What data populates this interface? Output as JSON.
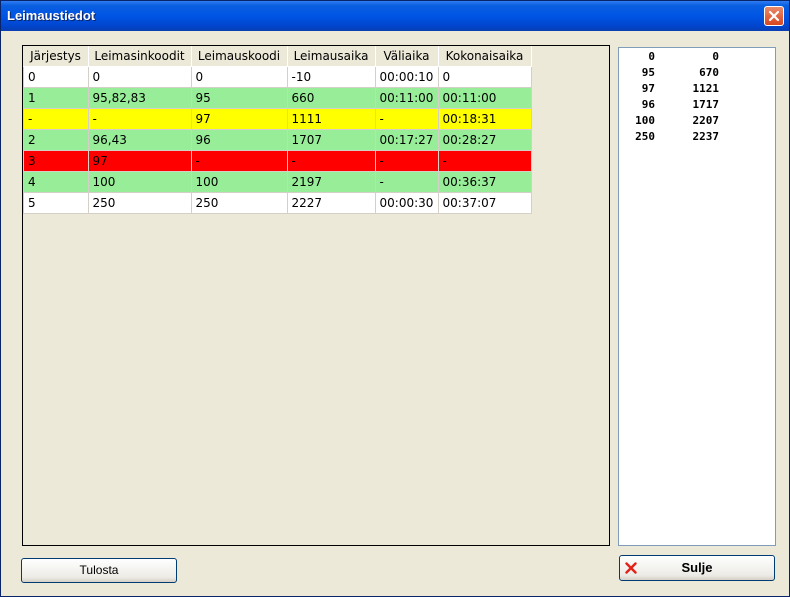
{
  "window": {
    "title": "Leimaustiedot"
  },
  "table": {
    "headers": [
      "Järjestys",
      "Leimasinkoodit",
      "Leimauskoodi",
      "Leimausaika",
      "Väliaika",
      "Kokonaisaika"
    ],
    "rows": [
      {
        "cells": [
          "0",
          "0",
          "0",
          "-10",
          "00:00:10",
          "0"
        ],
        "color": "#ffffff"
      },
      {
        "cells": [
          "1",
          "95,82,83",
          "95",
          "660",
          "00:11:00",
          "00:11:00"
        ],
        "color": "#98ee98"
      },
      {
        "cells": [
          "-",
          "-",
          "97",
          "1111",
          "-",
          "00:18:31"
        ],
        "color": "#ffff00"
      },
      {
        "cells": [
          "2",
          "96,43",
          "96",
          "1707",
          "00:17:27",
          "00:28:27"
        ],
        "color": "#98ee98"
      },
      {
        "cells": [
          "3",
          "97",
          "-",
          "-",
          "-",
          "-"
        ],
        "color": "#ff0000"
      },
      {
        "cells": [
          "4",
          "100",
          "100",
          "2197",
          "-",
          "00:36:37"
        ],
        "color": "#98ee98"
      },
      {
        "cells": [
          "5",
          "250",
          "250",
          "2227",
          "00:00:30",
          "00:37:07"
        ],
        "color": "#ffffff"
      }
    ]
  },
  "side_list": {
    "rows": [
      [
        "0",
        "0"
      ],
      [
        "95",
        "670"
      ],
      [
        "97",
        "1121"
      ],
      [
        "96",
        "1717"
      ],
      [
        "100",
        "2207"
      ],
      [
        "250",
        "2237"
      ]
    ]
  },
  "buttons": {
    "print_label": "Tulosta",
    "close_label": "Sulje"
  },
  "icons": {
    "close": "close-icon",
    "cancel": "x-icon"
  }
}
